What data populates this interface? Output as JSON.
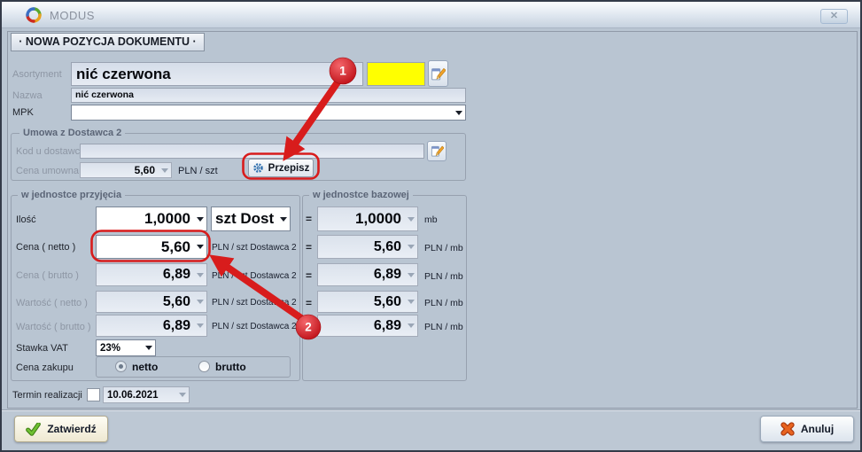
{
  "window": {
    "title": "MODUS",
    "close_glyph": "✕"
  },
  "header": {
    "title": "· NOWA POZYCJA DOKUMENTU ·"
  },
  "fields": {
    "asortyment": {
      "label": "Asortyment",
      "value": "nić czerwona"
    },
    "nazwa": {
      "label": "Nazwa",
      "value": "nić czerwona"
    },
    "mpk": {
      "label": "MPK",
      "value": ""
    }
  },
  "umowa_group": {
    "title": "Umowa z Dostawca 2",
    "kod_u_dostawcy": {
      "label": "Kod u dostawcy",
      "value": ""
    },
    "cena_umowna": {
      "label": "Cena umowna",
      "value": "5,60",
      "unit": "PLN / szt"
    },
    "przepisz_button": "Przepisz"
  },
  "przyjecia_group": {
    "title": "w jednostce przyjęcia",
    "rows": [
      {
        "label": "Ilość",
        "value": "1,0000",
        "unit": "szt Dost"
      },
      {
        "label": "Cena ( netto )",
        "value": "5,60",
        "unit": "PLN / szt Dostawca 2"
      },
      {
        "label": "Cena ( brutto )",
        "value": "6,89",
        "unit": "PLN / szt Dostawca 2"
      },
      {
        "label": "Wartość ( netto )",
        "value": "5,60",
        "unit": "PLN / szt Dostawca 2"
      },
      {
        "label": "Wartość ( brutto )",
        "value": "6,89",
        "unit": "PLN / szt Dostawca 2"
      }
    ],
    "stawka_vat": {
      "label": "Stawka VAT",
      "value": "23%"
    },
    "cena_zakupu": {
      "label": "Cena zakupu",
      "option_netto": "netto",
      "option_brutto": "brutto",
      "selected": "netto"
    }
  },
  "bazowa_group": {
    "title": "w jednostce bazowej",
    "equals": "=",
    "rows": [
      {
        "value": "1,0000",
        "unit": "mb"
      },
      {
        "value": "5,60",
        "unit": "PLN / mb"
      },
      {
        "value": "6,89",
        "unit": "PLN / mb"
      },
      {
        "value": "5,60",
        "unit": "PLN / mb"
      },
      {
        "value": "6,89",
        "unit": "PLN / mb"
      }
    ]
  },
  "termin": {
    "label": "Termin realizacji",
    "value": "10.06.2021",
    "checked": false
  },
  "footer": {
    "confirm_label": "Zatwierdź",
    "cancel_label": "Anuluj"
  },
  "annotations": {
    "step1": "1",
    "step2": "2"
  },
  "colors": {
    "annotation_red": "#dc1b1b",
    "highlight_yellow": "#ffff00",
    "dialog_bg": "#b9c5d2"
  }
}
